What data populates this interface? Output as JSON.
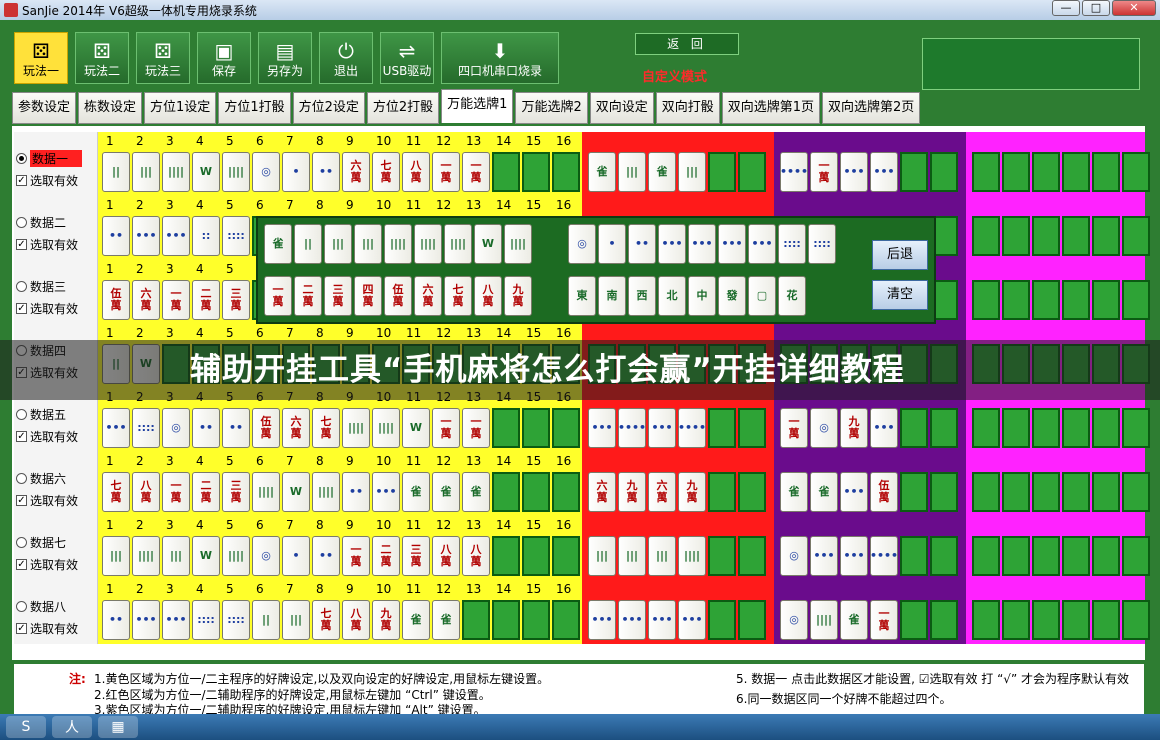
{
  "window": {
    "title": "SanJie 2014年 V6超级一体机专用烧录系统",
    "minimize": "—",
    "maximize": "□",
    "close": "✕"
  },
  "toolbar": [
    {
      "label": "玩法一",
      "icon": "dice-icon",
      "glyph": "⚄"
    },
    {
      "label": "玩法二",
      "icon": "dice-icon",
      "glyph": "⚄"
    },
    {
      "label": "玩法三",
      "icon": "dice-icon",
      "glyph": "⚄"
    },
    {
      "label": "保存",
      "icon": "save-icon",
      "glyph": "▣"
    },
    {
      "label": "另存为",
      "icon": "save-as-icon",
      "glyph": "▤"
    },
    {
      "label": "退出",
      "icon": "power-icon",
      "glyph": "⏻"
    },
    {
      "label": "USB驱动",
      "icon": "usb-icon",
      "glyph": "⇌"
    },
    {
      "label": "四口机串口烧录",
      "icon": "download-icon",
      "glyph": "⬇"
    }
  ],
  "back_label": "返 回",
  "custom_mode": "自定义模式",
  "tabs": [
    "参数设定",
    "栋数设定",
    "方位1设定",
    "方位1打骰",
    "方位2设定",
    "方位2打骰",
    "万能选牌1",
    "万能选牌2",
    "双向设定",
    "双向打骰",
    "双向选牌第1页",
    "双向选牌第2页"
  ],
  "numbers": [
    "1",
    "2",
    "3",
    "4",
    "5",
    "6",
    "7",
    "8",
    "9",
    "10",
    "11",
    "12",
    "13",
    "14",
    "15",
    "16"
  ],
  "valid_label": "选取有效",
  "rows": [
    {
      "name": "数据一",
      "selected": true,
      "tiles": [
        "||",
        "|||",
        "||||",
        "W",
        "||||",
        "◎",
        "•",
        "••",
        "六\n萬",
        "七\n萬",
        "八\n萬",
        "一\n萬",
        "一\n萬"
      ],
      "red": [
        "雀",
        "|||",
        "雀",
        "|||"
      ],
      "purple": [
        "••••",
        "一\n萬",
        "•••",
        "•••"
      ]
    },
    {
      "name": "数据二",
      "selected": false,
      "tiles": [
        "••",
        "•••",
        "•••",
        "::",
        "::::"
      ],
      "red": [],
      "purple": []
    },
    {
      "name": "数据三",
      "selected": false,
      "tiles": [
        "伍\n萬",
        "六\n萬",
        "一\n萬",
        "二\n萬",
        "三\n萬"
      ],
      "red": [],
      "purple": []
    },
    {
      "name": "数据四",
      "selected": false,
      "tiles": [
        "||",
        "W"
      ],
      "red": [],
      "purple": []
    },
    {
      "name": "数据五",
      "selected": false,
      "tiles": [
        "•••",
        "::::",
        "◎",
        "••",
        "••",
        "伍\n萬",
        "六\n萬",
        "七\n萬",
        "||||",
        "||||",
        "W",
        "一\n萬",
        "一\n萬"
      ],
      "red": [
        "•••",
        "••••",
        "•••",
        "••••"
      ],
      "purple": [
        "一\n萬",
        "◎",
        "九\n萬",
        "•••"
      ]
    },
    {
      "name": "数据六",
      "selected": false,
      "tiles": [
        "七\n萬",
        "八\n萬",
        "一\n萬",
        "二\n萬",
        "三\n萬",
        "||||",
        "W",
        "||||",
        "••",
        "•••",
        "雀",
        "雀",
        "雀"
      ],
      "red": [
        "六\n萬",
        "九\n萬",
        "六\n萬",
        "九\n萬"
      ],
      "purple": [
        "雀",
        "雀",
        "•••",
        "伍\n萬"
      ]
    },
    {
      "name": "数据七",
      "selected": false,
      "tiles": [
        "|||",
        "||||",
        "|||",
        "W",
        "||||",
        "◎",
        "•",
        "••",
        "一\n萬",
        "二\n萬",
        "三\n萬",
        "八\n萬",
        "八\n萬"
      ],
      "red": [
        "|||",
        "|||",
        "|||",
        "||||"
      ],
      "purple": [
        "◎",
        "•••",
        "•••",
        "••••"
      ]
    },
    {
      "name": "数据八",
      "selected": false,
      "tiles": [
        "••",
        "•••",
        "•••",
        "::::",
        "::::",
        "||",
        "|||",
        "七\n萬",
        "八\n萬",
        "九\n萬",
        "雀",
        "雀"
      ],
      "red": [
        "•••",
        "•••",
        "•••",
        "•••"
      ],
      "purple": [
        "◎",
        "||||",
        "雀",
        "一\n萬"
      ]
    }
  ],
  "overlay": {
    "bamboo": [
      "雀",
      "||",
      "|||",
      "|||",
      "||||",
      "||||",
      "||||",
      "W",
      "||||"
    ],
    "chars": [
      "一\n萬",
      "二\n萬",
      "三\n萬",
      "四\n萬",
      "伍\n萬",
      "六\n萬",
      "七\n萬",
      "八\n萬",
      "九\n萬"
    ],
    "dots": [
      "◎",
      "•",
      "••",
      "•••",
      "•••",
      "•••",
      "•••",
      "::::",
      "::::"
    ],
    "honors": [
      "東",
      "南",
      "西",
      "北",
      "中",
      "發",
      "▢",
      "花"
    ],
    "undo": "后退",
    "clear": "清空"
  },
  "banner": "辅助开挂工具“手机麻将怎么打会赢”开挂详细教程",
  "notes": {
    "heading": "注:",
    "lines": [
      "1.黄色区域为方位一/二主程序的好牌设定,以及双向设定的好牌设定,用鼠标左键设置。",
      "2.红色区域为方位一/二辅助程序的好牌设定,用鼠标左键加 “Ctrl” 键设置。",
      "3.紫色区域为方位一/二辅助程序的好牌设定,用鼠标左键加 “Alt” 键设置。"
    ],
    "right1": "5.  数据一 点击此数据区才能设置, ☑选取有效 打 “√” 才会为程序默认有效",
    "right2": "6.同一数据区同一个好牌不能超过四个。"
  },
  "taskbar": [
    "S",
    "人",
    "▦"
  ]
}
